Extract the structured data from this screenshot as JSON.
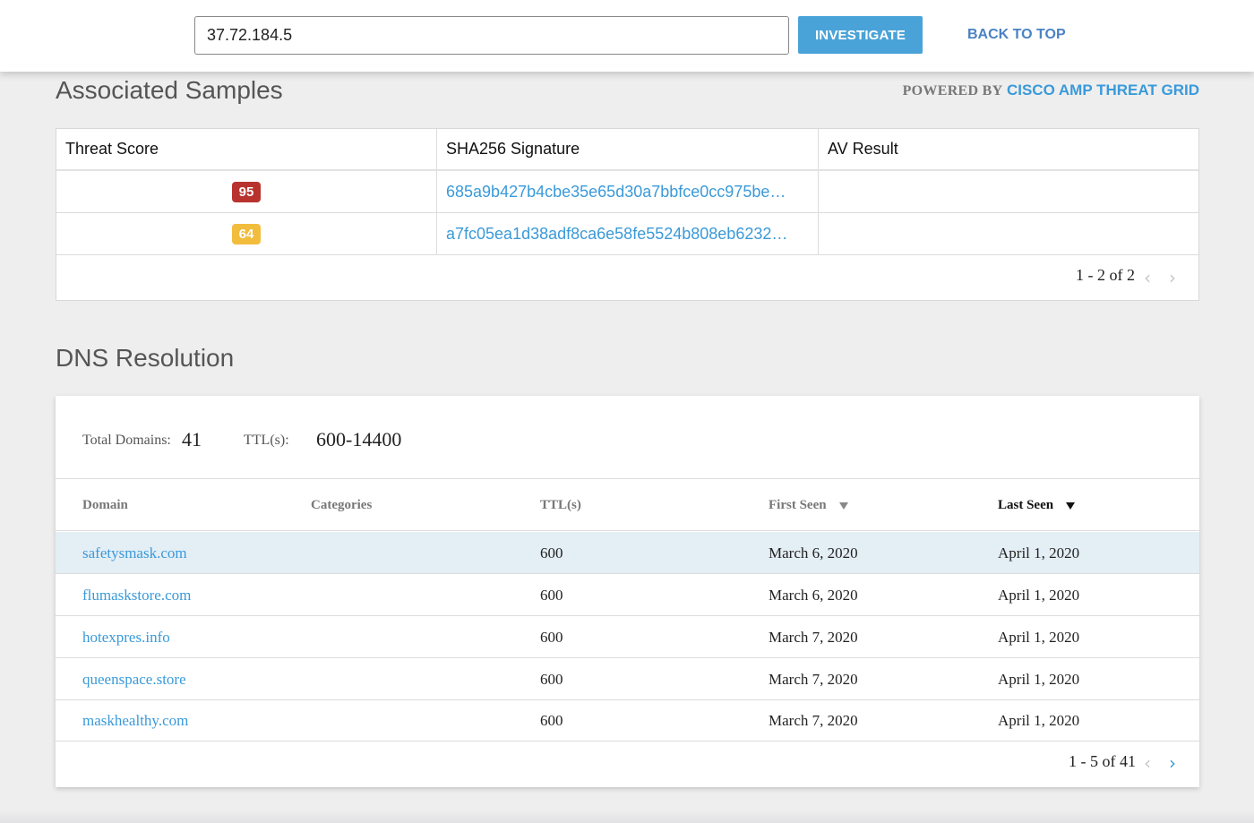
{
  "search": {
    "value": "37.72.184.5"
  },
  "header": {
    "investigate_label": "INVESTIGATE",
    "back_to_top_label": "BACK TO TOP"
  },
  "samples": {
    "title": "Associated Samples",
    "powered_by_prefix": "POWERED BY",
    "powered_by_brand": "CISCO AMP THREAT GRID",
    "columns": [
      "Threat Score",
      "SHA256 Signature",
      "AV Result"
    ],
    "rows": [
      {
        "score": "95",
        "score_color": "#b8332d",
        "sha": "685a9b427b4cbe35e65d30a7bbfce0cc975be…",
        "av": ""
      },
      {
        "score": "64",
        "score_color": "#f2bc3d",
        "sha": "a7fc05ea1d38adf8ca6e58fe5524b808eb6232…",
        "av": ""
      }
    ],
    "pager": "1 - 2 of 2"
  },
  "dns": {
    "title": "DNS Resolution",
    "total_domains_label": "Total Domains:",
    "total_domains_value": "41",
    "ttl_label": "TTL(s):",
    "ttl_value": "600-14400",
    "columns": [
      "Domain",
      "Categories",
      "TTL(s)",
      "First Seen",
      "Last Seen"
    ],
    "rows": [
      {
        "domain": "safetysmask.com",
        "categories": "",
        "ttl": "600",
        "first_seen": "March 6, 2020",
        "last_seen": "April 1, 2020"
      },
      {
        "domain": "flumaskstore.com",
        "categories": "",
        "ttl": "600",
        "first_seen": "March 6, 2020",
        "last_seen": "April 1, 2020"
      },
      {
        "domain": "hotexpres.info",
        "categories": "",
        "ttl": "600",
        "first_seen": "March 7, 2020",
        "last_seen": "April 1, 2020"
      },
      {
        "domain": "queenspace.store",
        "categories": "",
        "ttl": "600",
        "first_seen": "March 7, 2020",
        "last_seen": "April 1, 2020"
      },
      {
        "domain": "maskhealthy.com",
        "categories": "",
        "ttl": "600",
        "first_seen": "March 7, 2020",
        "last_seen": "April 1, 2020"
      }
    ],
    "pager": "1 - 5 of 41"
  },
  "icons": {
    "prev": "chevron-left-icon",
    "next": "chevron-right-icon",
    "sort": "sort-down-icon"
  },
  "colors": {
    "accent": "#4aa3d8",
    "link": "#3a9ad9",
    "highlight_row": "#e4eef5"
  }
}
